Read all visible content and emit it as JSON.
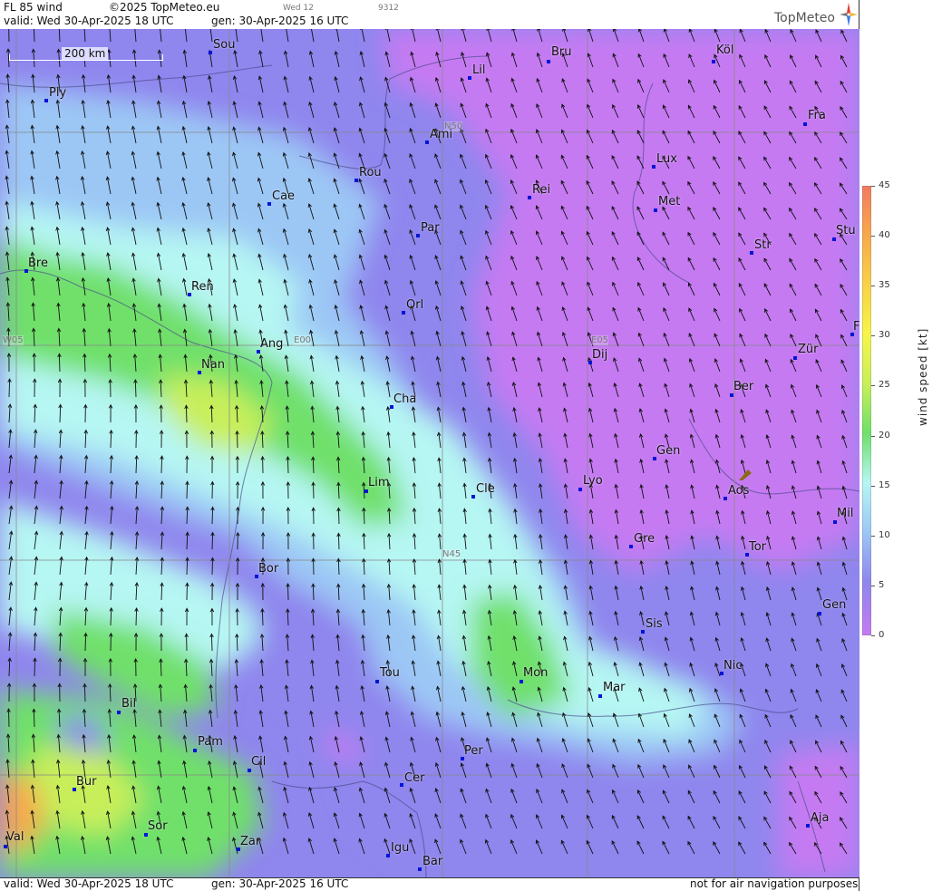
{
  "header": {
    "title": "FL 85 wind",
    "copyright": "©2025 TopMeteo.eu",
    "tab_small": "Wed 12",
    "code_small": "9312",
    "valid": "valid:  Wed  30-Apr-2025  18 UTC",
    "gen": "gen: 30-Apr-2025 16 UTC",
    "brand": "TopMeteo"
  },
  "footer": {
    "valid": "valid:  Wed  30-Apr-2025  18 UTC",
    "gen": "gen: 30-Apr-2025 16 UTC",
    "disclaimer": "not for air navigation purposes"
  },
  "scale_bar": {
    "label": "200 km"
  },
  "grid_labels": [
    "N50",
    "E00",
    "W05",
    "E05",
    "N45"
  ],
  "cities": [
    "Sou",
    "Ply",
    "Lil",
    "Bru",
    "Köl",
    "Fra",
    "Ami",
    "Rou",
    "Cae",
    "Lux",
    "Rei",
    "Met",
    "Par",
    "Str",
    "Stu",
    "Bre",
    "Ren",
    "Orl",
    "Ang",
    "Nan",
    "Dij",
    "Zür",
    "Ber",
    "Cha",
    "Gen",
    "Lim",
    "Cle",
    "Lyo",
    "Aos",
    "Mil",
    "Gre",
    "Tor",
    "Bor",
    "Sis",
    "Gen",
    "Nic",
    "Tou",
    "Mon",
    "Mar",
    "Bil",
    "Pam",
    "Cil",
    "Per",
    "Bur",
    "Cer",
    "Sor",
    "Aja",
    "Val",
    "Zar",
    "Igu",
    "Bar",
    "F"
  ],
  "legend": {
    "title": "wind speed [kt]",
    "ticks": [
      "45",
      "40",
      "35",
      "30",
      "25",
      "20",
      "15",
      "10",
      "5",
      "0"
    ],
    "colors": [
      "#f27a5e",
      "#f7a94c",
      "#f9d148",
      "#f7f54a",
      "#c8ef5a",
      "#6fe06a",
      "#b6f6f3",
      "#9cc7f5",
      "#8f86ee",
      "#c57af2"
    ]
  }
}
